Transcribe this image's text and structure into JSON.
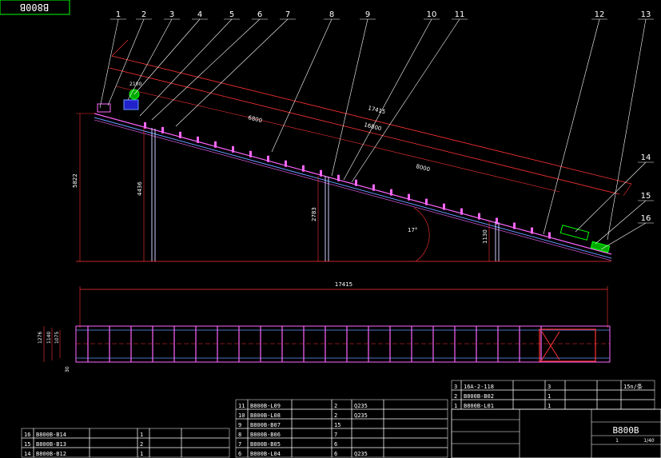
{
  "title_box": {
    "drawing_no": "B800B"
  },
  "callouts": [
    "1",
    "2",
    "3",
    "4",
    "5",
    "6",
    "7",
    "8",
    "9",
    "10",
    "11",
    "12",
    "13",
    "14",
    "15",
    "16"
  ],
  "dimensions": {
    "total_length_top": "17415",
    "length_inclined": "16800",
    "dim_6800": "6800",
    "dim_8000": "8000",
    "dim_2100": "2100",
    "height_total": "5822",
    "height_leg1": "4436",
    "height_leg2": "2783",
    "height_leg3": "1130",
    "angle": "17°",
    "plan_length": "17415",
    "plan_width_1": "1276",
    "plan_width_2": "1140",
    "plan_width_3": "1075",
    "plan_small": "30"
  },
  "parts_left": [
    {
      "no": "16",
      "code": "B800B-B14",
      "qty": "1"
    },
    {
      "no": "15",
      "code": "B800B-B13",
      "qty": "2"
    },
    {
      "no": "14",
      "code": "B800B-B12",
      "qty": "1"
    }
  ],
  "parts_mid": [
    {
      "no": "11",
      "code": "B800B-L09",
      "qty": "2",
      "mat": "Q235"
    },
    {
      "no": "10",
      "code": "B800B-L08",
      "qty": "2",
      "mat": "Q235"
    },
    {
      "no": "9",
      "code": "B800B-B07",
      "qty": "15",
      "mat": ""
    },
    {
      "no": "8",
      "code": "B800B-B06",
      "qty": "7",
      "mat": ""
    },
    {
      "no": "7",
      "code": "B800B-B05",
      "qty": "6",
      "mat": ""
    },
    {
      "no": "6",
      "code": "B800B-L04",
      "qty": "6",
      "mat": "Q235"
    }
  ],
  "parts_right": [
    {
      "no": "3",
      "code": "16A-2-118",
      "qty": "3",
      "note": "15n/条"
    },
    {
      "no": "2",
      "code": "B800B-B02",
      "qty": "1",
      "note": ""
    },
    {
      "no": "1",
      "code": "B800B-L01",
      "qty": "1",
      "note": ""
    }
  ],
  "title_block": {
    "name": "B800B",
    "scale": "1/40",
    "sheet": "1"
  },
  "colors": {
    "frame": "#00ff00",
    "dim": "#ff3333",
    "structure": "#ff66ff",
    "belt": "#6699ff",
    "leader": "#ffffff",
    "support": "#ccccff",
    "table": "#ffffff"
  }
}
